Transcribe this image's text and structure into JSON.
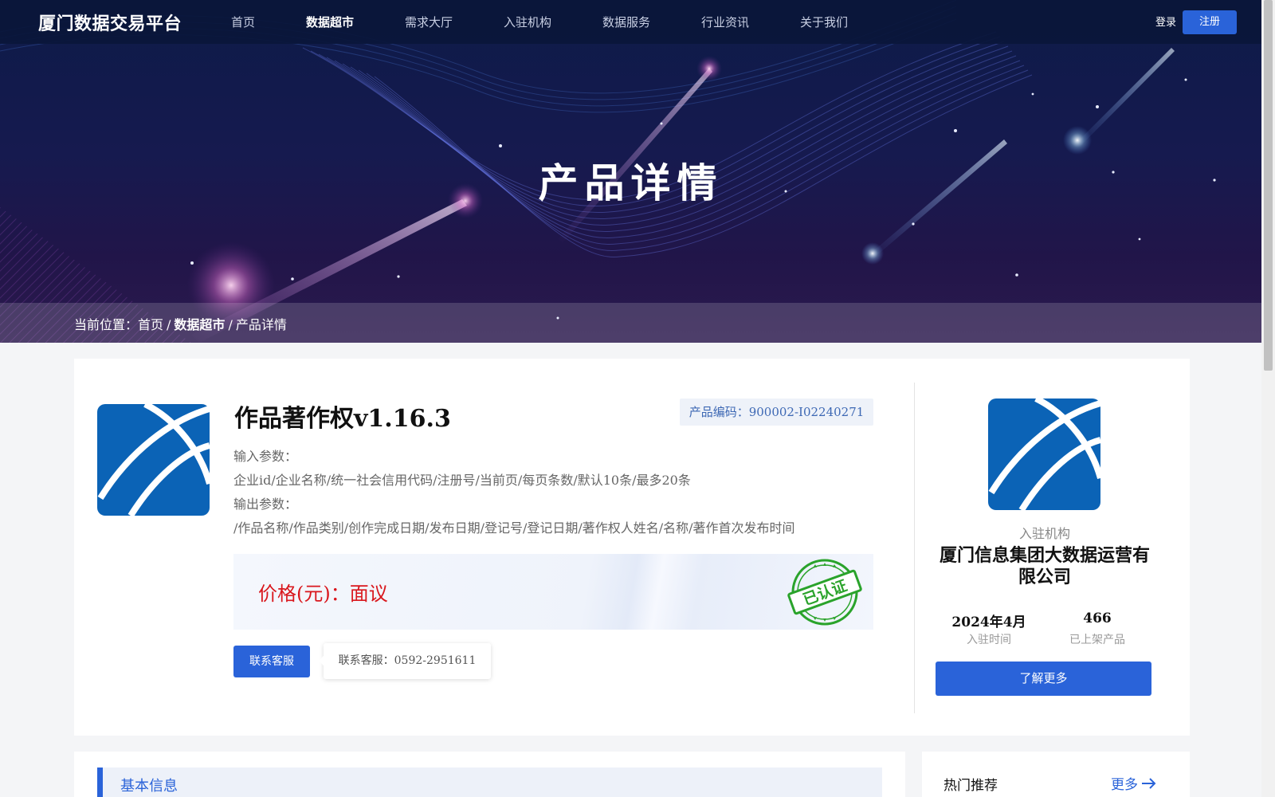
{
  "header": {
    "logo": "厦门数据交易平台",
    "nav": [
      {
        "label": "首页",
        "active": false
      },
      {
        "label": "数据超市",
        "active": true
      },
      {
        "label": "需求大厅",
        "active": false
      },
      {
        "label": "入驻机构",
        "active": false
      },
      {
        "label": "数据服务",
        "active": false
      },
      {
        "label": "行业资讯",
        "active": false
      },
      {
        "label": "关于我们",
        "active": false
      }
    ],
    "login": "登录",
    "register": "注册"
  },
  "banner": {
    "title": "产品详情",
    "breadcrumb": {
      "prefix": "当前位置：",
      "home": "首页",
      "separator": "/",
      "market": "数据超市",
      "current": "产品详情"
    }
  },
  "product": {
    "title": "作品著作权v1.16.3",
    "code_label": "产品编码：",
    "code": "900002-I02240271",
    "input_label": "输入参数：",
    "input_value": "企业id/企业名称/统一社会信用代码/注册号/当前页/每页条数/默认10条/最多20条",
    "output_label": "输出参数：",
    "output_value": "/作品名称/作品类别/创作完成日期/发布日期/登记号/登记日期/著作权人姓名/名称/著作首次发布时间",
    "price_label": "价格(元)：",
    "price_value": "面议",
    "stamp_text": "已认证",
    "contact_button": "联系客服",
    "contact_popup_label": "联系客服：",
    "contact_phone": "0592-2951611"
  },
  "org": {
    "label": "入驻机构",
    "name": "厦门信息集团大数据运营有限公司",
    "join_date": "2024年4月",
    "join_label": "入驻时间",
    "product_count": "466",
    "product_label": "已上架产品",
    "more_button": "了解更多"
  },
  "sections": {
    "basic_info": "基本信息",
    "hot": "热门推荐",
    "more": "更多"
  },
  "colors": {
    "accent": "#2a63d9",
    "logo_blue": "#0b63b6",
    "price_red": "#d9171d",
    "stamp_green": "#2aa32b"
  }
}
